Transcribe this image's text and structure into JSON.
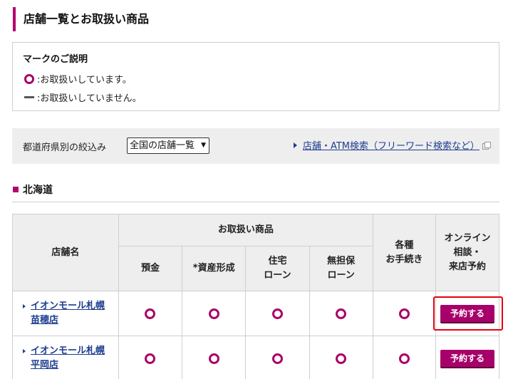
{
  "page_title": "店舗一覧とお取扱い商品",
  "legend": {
    "title": "マークのご説明",
    "available": ":お取扱いしています。",
    "unavailable": ":お取扱いしていません。"
  },
  "filter": {
    "label": "都道府県別の絞込み",
    "selected": "全国の店舗一覧",
    "search_link": "店舗・ATM検索（フリーワード検索など）"
  },
  "region": {
    "title": "北海道"
  },
  "table": {
    "headers": {
      "store_name": "店舗名",
      "products_group": "お取扱い商品",
      "deposit": "預金",
      "asset": "*資産形成",
      "housing_loan_1": "住宅",
      "housing_loan_2": "ローン",
      "unsecured_loan_1": "無担保",
      "unsecured_loan_2": "ローン",
      "procedures_1": "各種",
      "procedures_2": "お手続き",
      "online_1": "オンライン",
      "online_2": "相談・",
      "online_3": "来店予約"
    },
    "rows": [
      {
        "name_line1": "イオンモール札幌",
        "name_line2": "苗穂店",
        "reserve_label": "予約する",
        "marks": [
          "available",
          "available",
          "available",
          "available",
          "available"
        ]
      },
      {
        "name_line1": "イオンモール札幌",
        "name_line2": "平岡店",
        "reserve_label": "予約する",
        "marks": [
          "available",
          "available",
          "available",
          "available",
          "available"
        ]
      }
    ]
  },
  "colors": {
    "accent": "#b5006f",
    "link": "#1d3d8f",
    "highlight": "#e60012"
  }
}
